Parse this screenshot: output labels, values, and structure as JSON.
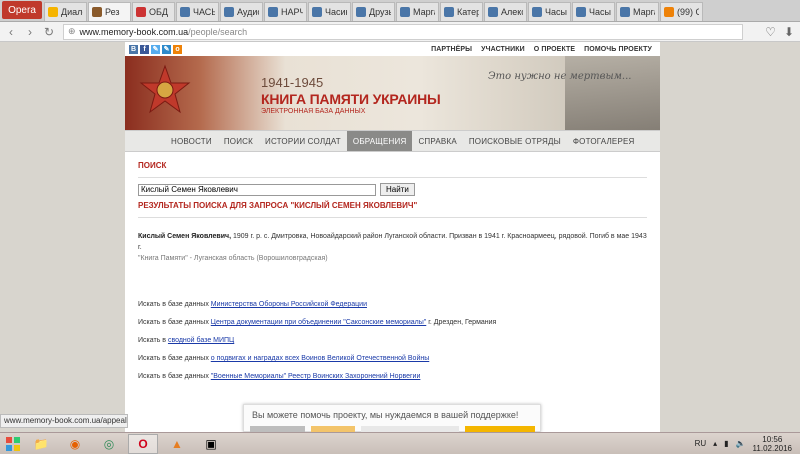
{
  "browser": {
    "menu_label": "Opera",
    "tabs": [
      {
        "label": "Диало",
        "icon_color": "#f5b400",
        "active": false
      },
      {
        "label": "Рез",
        "icon_color": "#8a5a2b",
        "active": true
      },
      {
        "label": "ОБД М",
        "icon_color": "#cc3333",
        "active": false
      },
      {
        "label": "ЧАСЫ",
        "icon_color": "#4a76a8",
        "active": false
      },
      {
        "label": "Аудио",
        "icon_color": "#4a76a8",
        "active": false
      },
      {
        "label": "НАРЧ",
        "icon_color": "#4a76a8",
        "active": false
      },
      {
        "label": "Часин",
        "icon_color": "#4a76a8",
        "active": false
      },
      {
        "label": "Друзь",
        "icon_color": "#4a76a8",
        "active": false
      },
      {
        "label": "Марга",
        "icon_color": "#4a76a8",
        "active": false
      },
      {
        "label": "Катер",
        "icon_color": "#4a76a8",
        "active": false
      },
      {
        "label": "Алекс",
        "icon_color": "#4a76a8",
        "active": false
      },
      {
        "label": "Часы",
        "icon_color": "#4a76a8",
        "active": false
      },
      {
        "label": "Часы н",
        "icon_color": "#4a76a8",
        "active": false
      },
      {
        "label": "Марга",
        "icon_color": "#4a76a8",
        "active": false
      },
      {
        "label": "(99) О",
        "icon_color": "#ee8208",
        "active": false
      }
    ],
    "url_host": "www.memory-book.com.ua",
    "url_path": "/people/search"
  },
  "site": {
    "social_icons": [
      {
        "name": "vk-icon",
        "glyph": "В",
        "color": "#4a76a8"
      },
      {
        "name": "facebook-icon",
        "glyph": "f",
        "color": "#3b5998"
      },
      {
        "name": "twitter-icon",
        "glyph": "✎",
        "color": "#55acee"
      },
      {
        "name": "lj-icon",
        "glyph": "✎",
        "color": "#2d8acb"
      },
      {
        "name": "odnoklassniki-icon",
        "glyph": "о",
        "color": "#ee8208"
      }
    ],
    "top_links": [
      "ПАРТНЁРЫ",
      "УЧАСТНИКИ",
      "О ПРОЕКТЕ",
      "ПОМОЧЬ ПРОЕКТУ"
    ],
    "banner": {
      "years": "1941-1945",
      "title": "КНИГА ПАМЯТИ УКРАИНЫ",
      "subtitle": "ЭЛЕКТРОННАЯ БАЗА ДАННЫХ",
      "script": "Это нужно не мертвым..."
    },
    "nav": [
      {
        "label": "НОВОСТИ",
        "active": false
      },
      {
        "label": "ПОИСК",
        "active": false
      },
      {
        "label": "ИСТОРИИ СОЛДАТ",
        "active": false
      },
      {
        "label": "ОБРАЩЕНИЯ",
        "active": true
      },
      {
        "label": "СПРАВКА",
        "active": false
      },
      {
        "label": "ПОИСКОВЫЕ ОТРЯДЫ",
        "active": false
      },
      {
        "label": "ФОТОГАЛЕРЕЯ",
        "active": false
      }
    ],
    "search": {
      "heading": "ПОИСК",
      "value": "Кислый Семен Яковлевич",
      "button": "Найти"
    },
    "results_heading": "РЕЗУЛЬТАТЫ ПОИСКА ДЛЯ ЗАПРОСА \"КИСЛЫЙ СЕМЕН ЯКОВЛЕВИЧ\"",
    "result": {
      "name": "Кислый Семен Яковлевич,",
      "text": " 1909 г. р. с. Дмитровка, Новоайдарский район Луганской области. Призван в 1941 г. Красноармеец, рядовой. Погиб в мае 1943 г.",
      "source": "\"Книга Памяти\" - Луганская область (Ворошиловградская)"
    },
    "external": [
      {
        "prefix": "Искать в базе данных ",
        "link": "Министерства Обороны Российской Федерации",
        "suffix": ""
      },
      {
        "prefix": "Искать в базе данных ",
        "link": "Центра документации при объединении \"Саксонские мемориалы\"",
        "suffix": " г. Дрезден, Германия"
      },
      {
        "prefix": "Искать в ",
        "link": "сводной базе МИПЦ",
        "suffix": ""
      },
      {
        "prefix": "Искать в базе данных ",
        "link": "о подвигах и наградах всех Воинов Великой Отечественной Войны",
        "suffix": ""
      },
      {
        "prefix": "Искать в базе данных ",
        "link": "\"Военные Мемориалы\" Реестр Воинских Захоронений Норвегии",
        "suffix": ""
      }
    ]
  },
  "status_url": "www.memory-book.com.ua/appeals",
  "donate_text": "Вы можете помочь проекту, мы нуждаемся в вашей поддержке!",
  "taskbar": {
    "apps": [
      {
        "name": "explorer-icon",
        "glyph": "📁",
        "active": false
      },
      {
        "name": "firefox-icon",
        "glyph": "◉",
        "active": false
      },
      {
        "name": "chrome-icon",
        "glyph": "◎",
        "active": false
      },
      {
        "name": "opera-icon",
        "glyph": "O",
        "active": true
      },
      {
        "name": "aimp-icon",
        "glyph": "▲",
        "active": false
      },
      {
        "name": "media-icon",
        "glyph": "▣",
        "active": false
      }
    ],
    "lang": "RU",
    "time": "10:56",
    "date": "11.02.2016"
  }
}
